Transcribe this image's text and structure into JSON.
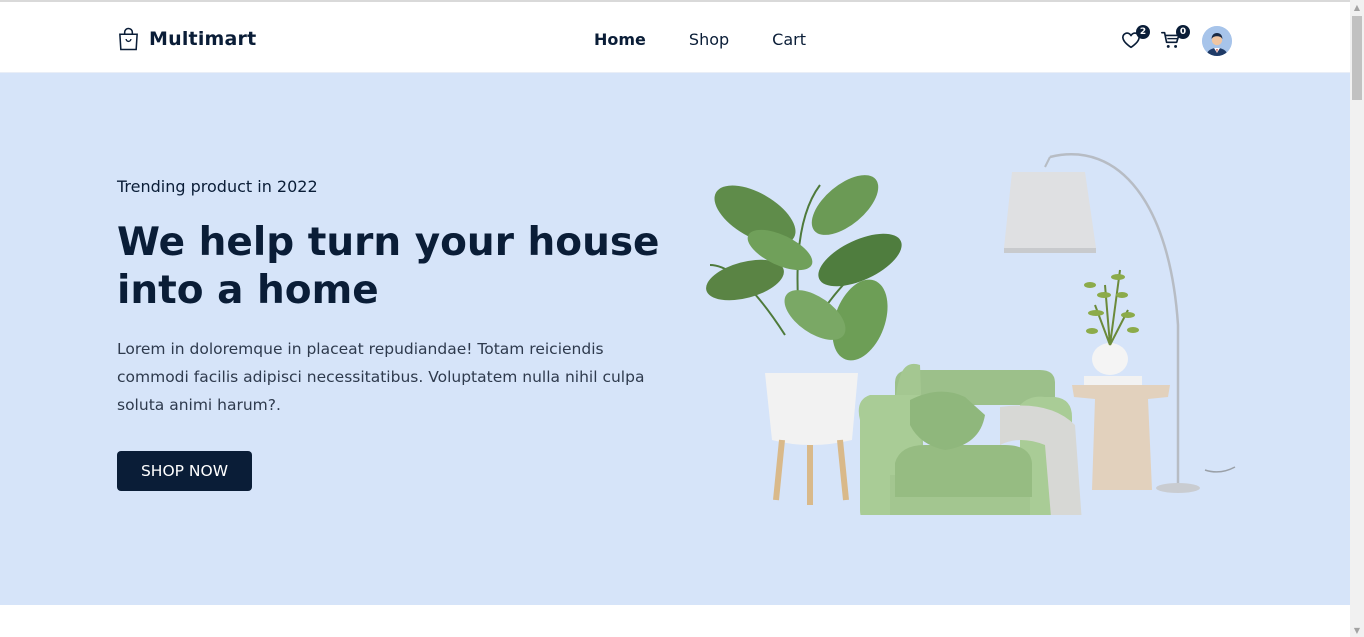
{
  "brand": {
    "name": "Multimart",
    "logo_icon": "shopping-bag-icon"
  },
  "nav": {
    "items": [
      {
        "label": "Home",
        "active": true
      },
      {
        "label": "Shop",
        "active": false
      },
      {
        "label": "Cart",
        "active": false
      }
    ]
  },
  "header_icons": {
    "wishlist": {
      "icon": "heart-icon",
      "count": "2"
    },
    "cart": {
      "icon": "cart-icon",
      "count": "0"
    },
    "profile": {
      "icon": "user-avatar-icon"
    }
  },
  "hero": {
    "subtitle": "Trending product in 2022",
    "headline": "We help turn your house into a home",
    "description": "Lorem in doloremque in placeat repudiandae! Totam reiciendis commodi facilis adipisci necessitatibus. Voluptatem nulla nihil culpa soluta animi harum?.",
    "cta_label": "SHOP NOW",
    "image": "furniture-armchair-plant-lamp-illustration"
  },
  "colors": {
    "primary": "#0a1d37",
    "hero_background": "#d6e4f9",
    "header_background": "#ffffff"
  }
}
